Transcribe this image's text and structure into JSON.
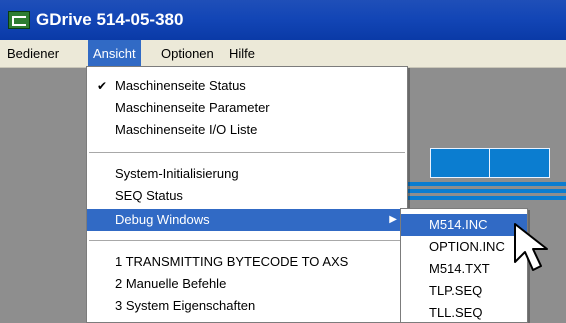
{
  "window": {
    "title": "GDrive 514-05-380",
    "icon": "app-icon"
  },
  "menubar": {
    "items": [
      "Bediener",
      "Ansicht",
      "Optionen",
      "Hilfe"
    ],
    "active": "Ansicht"
  },
  "menu": {
    "group1": [
      "Maschinenseite Status",
      "Maschinenseite Parameter",
      "Maschinenseite I/O Liste"
    ],
    "group1_checked": "Maschinenseite Status",
    "group2": [
      "System-Initialisierung",
      "SEQ Status",
      "Debug Windows"
    ],
    "highlighted": "Debug Windows",
    "group3": [
      "1 TRANSMITTING BYTECODE TO AXS",
      "2 Manuelle Befehle",
      "3 System Eigenschaften"
    ]
  },
  "submenu": {
    "items": [
      "M514.INC",
      "OPTION.INC",
      "M514.TXT",
      "TLP.SEQ",
      "TLL.SEQ"
    ],
    "highlighted": "M514.INC"
  },
  "colors": {
    "accent": "#316ac5",
    "title_bar": "#1346b6",
    "workspace": "#8e8e8e",
    "panel_blue": "#0b7dd0"
  }
}
